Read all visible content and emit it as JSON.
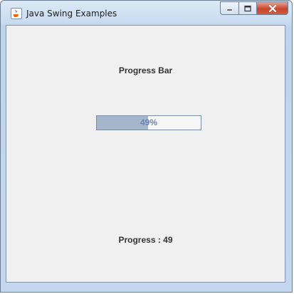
{
  "window": {
    "title": "Java Swing Examples",
    "icon": "java-coffee-icon"
  },
  "controls": {
    "minimize": "minimize-icon",
    "maximize": "maximize-icon",
    "close": "close-icon"
  },
  "content": {
    "heading": "Progress Bar",
    "progress": {
      "value": 49,
      "text": "49%",
      "fill_color": "#a5b6cc"
    },
    "status": "Progress : 49"
  }
}
